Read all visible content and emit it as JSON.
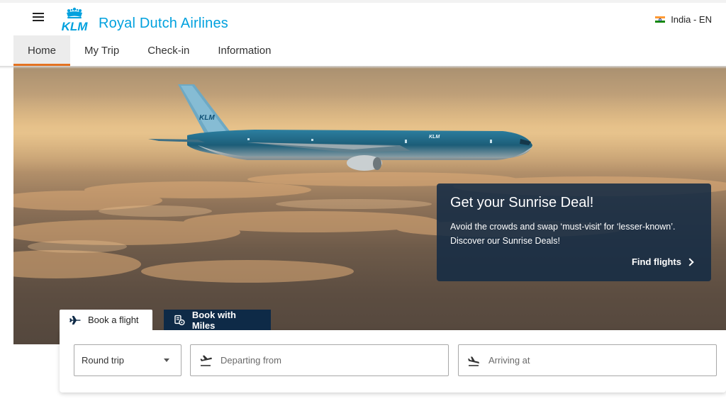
{
  "header": {
    "brand_logo_text": "KLM",
    "brand_name": "Royal Dutch Airlines",
    "locale_label": "India - EN",
    "brand_color": "#00a1de",
    "accent_color": "#e37222"
  },
  "nav": {
    "tabs": [
      {
        "label": "Home",
        "active": true
      },
      {
        "label": "My Trip",
        "active": false
      },
      {
        "label": "Check-in",
        "active": false
      },
      {
        "label": "Information",
        "active": false
      }
    ]
  },
  "hero": {
    "aircraft_livery_text": "KLM"
  },
  "promo": {
    "title": "Get your Sunrise Deal!",
    "text_line1": "Avoid the crowds and swap ‘must-visit’ for ‘lesser-known’.",
    "text_line2": "Discover our Sunrise Deals!",
    "link_label": "Find flights"
  },
  "booking": {
    "tabs": [
      {
        "label": "Book a flight",
        "icon": "plane-icon",
        "active": true
      },
      {
        "label": "Book with Miles",
        "icon": "miles-icon",
        "active": false
      }
    ],
    "trip_type": {
      "selected": "Round trip"
    },
    "departure": {
      "placeholder": "Departing from"
    },
    "arrival": {
      "placeholder": "Arriving at"
    }
  }
}
